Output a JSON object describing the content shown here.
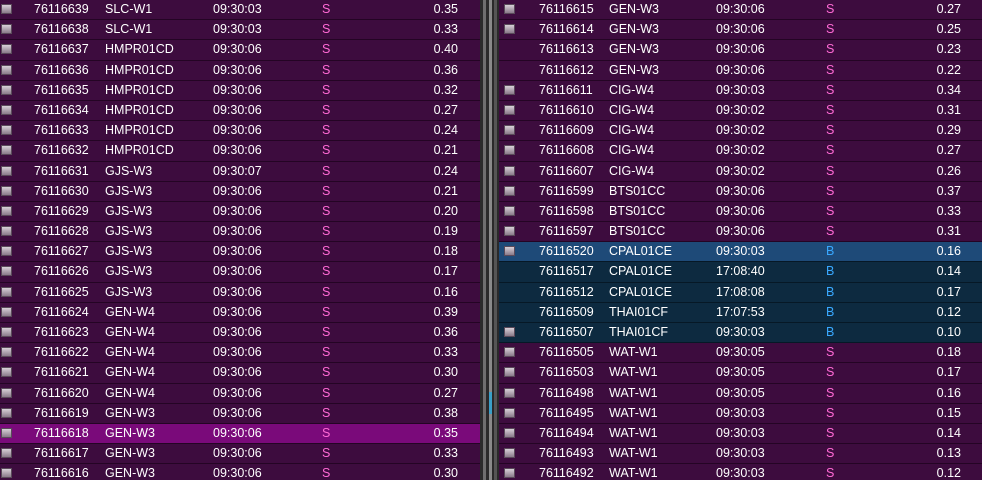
{
  "colors": {
    "sell_side": "#ff6ad5",
    "buy_side": "#39a8ff",
    "row_bg": "#3d0c3e",
    "highlight_row": "#7a0a7a",
    "buy_row": "#0d2a40",
    "selected_buy_row": "#1e4a78"
  },
  "left_panel": {
    "rows": [
      {
        "id": "76116639",
        "account": "SLC-W1",
        "time": "09:30:03",
        "side": "S",
        "price": "0.35",
        "checkbox": true
      },
      {
        "id": "76116638",
        "account": "SLC-W1",
        "time": "09:30:03",
        "side": "S",
        "price": "0.33",
        "checkbox": true
      },
      {
        "id": "76116637",
        "account": "HMPR01CD",
        "time": "09:30:06",
        "side": "S",
        "price": "0.40",
        "checkbox": true
      },
      {
        "id": "76116636",
        "account": "HMPR01CD",
        "time": "09:30:06",
        "side": "S",
        "price": "0.36",
        "checkbox": true
      },
      {
        "id": "76116635",
        "account": "HMPR01CD",
        "time": "09:30:06",
        "side": "S",
        "price": "0.32",
        "checkbox": true
      },
      {
        "id": "76116634",
        "account": "HMPR01CD",
        "time": "09:30:06",
        "side": "S",
        "price": "0.27",
        "checkbox": true
      },
      {
        "id": "76116633",
        "account": "HMPR01CD",
        "time": "09:30:06",
        "side": "S",
        "price": "0.24",
        "checkbox": true
      },
      {
        "id": "76116632",
        "account": "HMPR01CD",
        "time": "09:30:06",
        "side": "S",
        "price": "0.21",
        "checkbox": true
      },
      {
        "id": "76116631",
        "account": "GJS-W3",
        "time": "09:30:07",
        "side": "S",
        "price": "0.24",
        "checkbox": true
      },
      {
        "id": "76116630",
        "account": "GJS-W3",
        "time": "09:30:06",
        "side": "S",
        "price": "0.21",
        "checkbox": true
      },
      {
        "id": "76116629",
        "account": "GJS-W3",
        "time": "09:30:06",
        "side": "S",
        "price": "0.20",
        "checkbox": true
      },
      {
        "id": "76116628",
        "account": "GJS-W3",
        "time": "09:30:06",
        "side": "S",
        "price": "0.19",
        "checkbox": true
      },
      {
        "id": "76116627",
        "account": "GJS-W3",
        "time": "09:30:06",
        "side": "S",
        "price": "0.18",
        "checkbox": true
      },
      {
        "id": "76116626",
        "account": "GJS-W3",
        "time": "09:30:06",
        "side": "S",
        "price": "0.17",
        "checkbox": true
      },
      {
        "id": "76116625",
        "account": "GJS-W3",
        "time": "09:30:06",
        "side": "S",
        "price": "0.16",
        "checkbox": true
      },
      {
        "id": "76116624",
        "account": "GEN-W4",
        "time": "09:30:06",
        "side": "S",
        "price": "0.39",
        "checkbox": true
      },
      {
        "id": "76116623",
        "account": "GEN-W4",
        "time": "09:30:06",
        "side": "S",
        "price": "0.36",
        "checkbox": true
      },
      {
        "id": "76116622",
        "account": "GEN-W4",
        "time": "09:30:06",
        "side": "S",
        "price": "0.33",
        "checkbox": true
      },
      {
        "id": "76116621",
        "account": "GEN-W4",
        "time": "09:30:06",
        "side": "S",
        "price": "0.30",
        "checkbox": true
      },
      {
        "id": "76116620",
        "account": "GEN-W4",
        "time": "09:30:06",
        "side": "S",
        "price": "0.27",
        "checkbox": true
      },
      {
        "id": "76116619",
        "account": "GEN-W3",
        "time": "09:30:06",
        "side": "S",
        "price": "0.38",
        "checkbox": true
      },
      {
        "id": "76116618",
        "account": "GEN-W3",
        "time": "09:30:06",
        "side": "S",
        "price": "0.35",
        "checkbox": true,
        "highlight": true
      },
      {
        "id": "76116617",
        "account": "GEN-W3",
        "time": "09:30:06",
        "side": "S",
        "price": "0.33",
        "checkbox": true
      },
      {
        "id": "76116616",
        "account": "GEN-W3",
        "time": "09:30:06",
        "side": "S",
        "price": "0.30",
        "checkbox": true
      }
    ]
  },
  "right_panel": {
    "rows": [
      {
        "id": "76116615",
        "account": "GEN-W3",
        "time": "09:30:06",
        "side": "S",
        "price": "0.27",
        "checkbox": true
      },
      {
        "id": "76116614",
        "account": "GEN-W3",
        "time": "09:30:06",
        "side": "S",
        "price": "0.25",
        "checkbox": true
      },
      {
        "id": "76116613",
        "account": "GEN-W3",
        "time": "09:30:06",
        "side": "S",
        "price": "0.23",
        "checkbox": false
      },
      {
        "id": "76116612",
        "account": "GEN-W3",
        "time": "09:30:06",
        "side": "S",
        "price": "0.22",
        "checkbox": false
      },
      {
        "id": "76116611",
        "account": "CIG-W4",
        "time": "09:30:03",
        "side": "S",
        "price": "0.34",
        "checkbox": true
      },
      {
        "id": "76116610",
        "account": "CIG-W4",
        "time": "09:30:02",
        "side": "S",
        "price": "0.31",
        "checkbox": true
      },
      {
        "id": "76116609",
        "account": "CIG-W4",
        "time": "09:30:02",
        "side": "S",
        "price": "0.29",
        "checkbox": true
      },
      {
        "id": "76116608",
        "account": "CIG-W4",
        "time": "09:30:02",
        "side": "S",
        "price": "0.27",
        "checkbox": true
      },
      {
        "id": "76116607",
        "account": "CIG-W4",
        "time": "09:30:02",
        "side": "S",
        "price": "0.26",
        "checkbox": true
      },
      {
        "id": "76116599",
        "account": "BTS01CC",
        "time": "09:30:06",
        "side": "S",
        "price": "0.37",
        "checkbox": true
      },
      {
        "id": "76116598",
        "account": "BTS01CC",
        "time": "09:30:06",
        "side": "S",
        "price": "0.33",
        "checkbox": true
      },
      {
        "id": "76116597",
        "account": "BTS01CC",
        "time": "09:30:06",
        "side": "S",
        "price": "0.31",
        "checkbox": true
      },
      {
        "id": "76116520",
        "account": "CPAL01CE",
        "time": "09:30:03",
        "side": "B",
        "price": "0.16",
        "checkbox": true,
        "buy": true,
        "selected": true
      },
      {
        "id": "76116517",
        "account": "CPAL01CE",
        "time": "17:08:40",
        "side": "B",
        "price": "0.14",
        "checkbox": false,
        "buy": true
      },
      {
        "id": "76116512",
        "account": "CPAL01CE",
        "time": "17:08:08",
        "side": "B",
        "price": "0.17",
        "checkbox": false,
        "buy": true
      },
      {
        "id": "76116509",
        "account": "THAI01CF",
        "time": "17:07:53",
        "side": "B",
        "price": "0.12",
        "checkbox": false,
        "buy": true
      },
      {
        "id": "76116507",
        "account": "THAI01CF",
        "time": "09:30:03",
        "side": "B",
        "price": "0.10",
        "checkbox": true,
        "buy": true
      },
      {
        "id": "76116505",
        "account": "WAT-W1",
        "time": "09:30:05",
        "side": "S",
        "price": "0.18",
        "checkbox": true
      },
      {
        "id": "76116503",
        "account": "WAT-W1",
        "time": "09:30:05",
        "side": "S",
        "price": "0.17",
        "checkbox": true
      },
      {
        "id": "76116498",
        "account": "WAT-W1",
        "time": "09:30:05",
        "side": "S",
        "price": "0.16",
        "checkbox": true
      },
      {
        "id": "76116495",
        "account": "WAT-W1",
        "time": "09:30:03",
        "side": "S",
        "price": "0.15",
        "checkbox": true
      },
      {
        "id": "76116494",
        "account": "WAT-W1",
        "time": "09:30:03",
        "side": "S",
        "price": "0.14",
        "checkbox": true
      },
      {
        "id": "76116493",
        "account": "WAT-W1",
        "time": "09:30:03",
        "side": "S",
        "price": "0.13",
        "checkbox": true
      },
      {
        "id": "76116492",
        "account": "WAT-W1",
        "time": "09:30:03",
        "side": "S",
        "price": "0.12",
        "checkbox": true
      }
    ]
  }
}
